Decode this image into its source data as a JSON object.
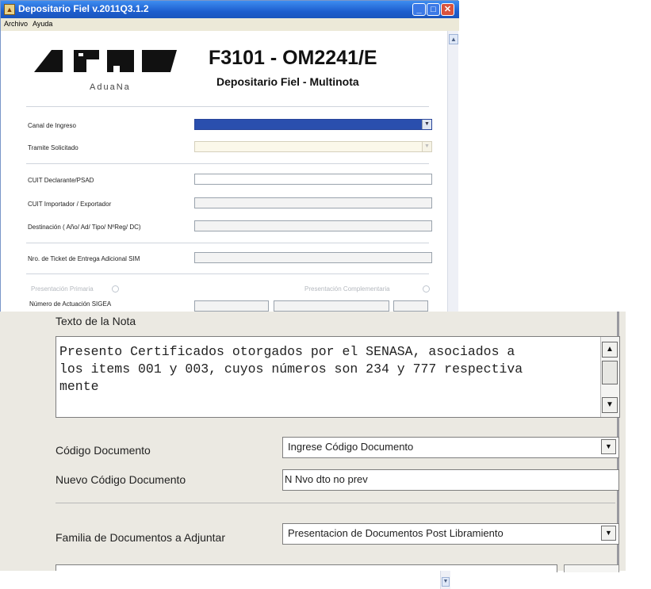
{
  "window": {
    "title": "Depositario Fiel v.2011Q3.1.2",
    "controls": {
      "minimize": "_",
      "maximize": "□",
      "close": "✕"
    }
  },
  "menu": [
    "Archivo",
    "Ayuda"
  ],
  "header": {
    "logo_sub": "AduaNa",
    "form_code": "F3101 - OM2241/E",
    "subtitle": "Depositario Fiel - Multinota"
  },
  "form": {
    "canal": {
      "label": "Canal de Ingreso"
    },
    "tramite": {
      "label": "Tramite Solicitado"
    },
    "cuit_declarante": {
      "label": "CUIT Declarante/PSAD",
      "value": ""
    },
    "cuit_importador": {
      "label": "CUIT Importador / Exportador",
      "value": ""
    },
    "destinacion": {
      "label": "Destinación ( Año/  Ad/ Tipo/ NºReg/ DC)",
      "value": ""
    },
    "ticket": {
      "label": "Nro. de Ticket de Entrega Adicional SIM",
      "value": ""
    },
    "presentacion_primaria": {
      "label": "Presentación Primaria"
    },
    "presentacion_complementaria": {
      "label": "Presentación Complementaria"
    },
    "numero_actuacion": {
      "label": "Número de Actuación SIGEA"
    }
  },
  "panel": {
    "nota_label": "Texto de la Nota",
    "nota_text": "Presento Certificados otorgados por el SENASA, asociados a\nlos items 001 y 003, cuyos números son 234 y 777 respectiva\nmente",
    "codigo_documento": {
      "label": "Código Documento",
      "value": "Ingrese Código Documento"
    },
    "nuevo_codigo": {
      "label": "Nuevo Código Documento",
      "value": "N Nvo dto no prev"
    },
    "familia": {
      "label": "Familia de Documentos a Adjuntar",
      "value": "Presentacion de Documentos Post Libramiento"
    }
  },
  "icons": {
    "dropdown": "chevron-down-icon",
    "scroll_up": "triangle-up-icon",
    "scroll_down": "triangle-down-icon"
  },
  "colors": {
    "titlebar": "#1e5fcf",
    "canal_selected": "#2a4fae",
    "close_button": "#d9533d"
  }
}
